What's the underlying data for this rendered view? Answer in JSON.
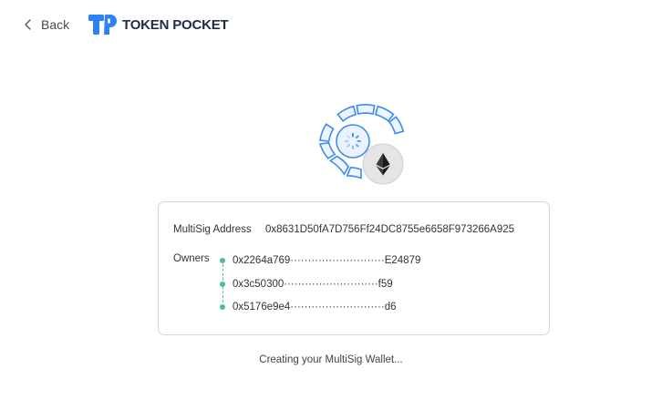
{
  "header": {
    "back_label": "Back",
    "brand_name": "TOKEN POCKET"
  },
  "graphic": {
    "center_icon": "loading-spinner-icon",
    "badge_icon": "ethereum-icon",
    "accent_color": "#3d8cf0",
    "badge_color": "#e5e5e5"
  },
  "card": {
    "multisig_label": "MultiSig Address",
    "multisig_address": "0x8631D50fA7D756Ff24DC8755e6658F973266A925",
    "owners_label": "Owners",
    "owners": [
      "0x2264a769···························E24879",
      "0x3c50300···························f59",
      "0x5176e9e4···························d6"
    ],
    "owner_status_color": "#4cbf8a"
  },
  "status_text": "Creating your MultiSig Wallet..."
}
